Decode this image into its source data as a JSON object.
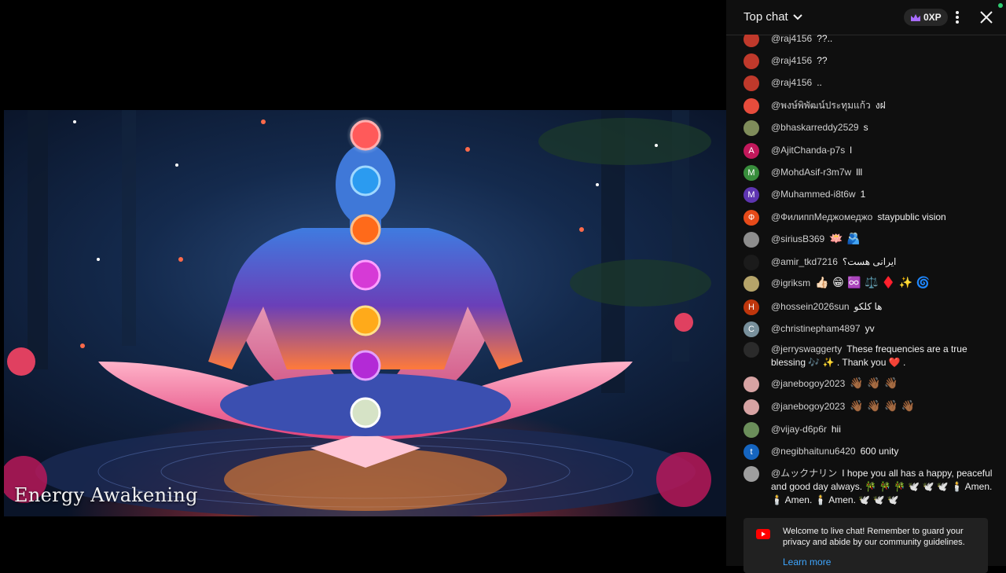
{
  "video": {
    "caption": "Energy Awakening"
  },
  "chat": {
    "title": "Top chat",
    "xp_label": "0XP",
    "welcome_text": "Welcome to live chat! Remember to guard your privacy and abide by our community guidelines.",
    "learn_more": "Learn more",
    "messages": [
      {
        "author": "@raj4156",
        "text": "??..",
        "avatar_letter": "",
        "avatar_color": "#c0392b"
      },
      {
        "author": "@raj4156",
        "text": "??",
        "avatar_letter": "",
        "avatar_color": "#c0392b"
      },
      {
        "author": "@raj4156",
        "text": "..",
        "avatar_letter": "",
        "avatar_color": "#c0392b"
      },
      {
        "author": "@พงษ์พิพัฒน์ประทุมแก้ว",
        "text": "งฝ",
        "avatar_letter": "",
        "avatar_color": "#e74c3c"
      },
      {
        "author": "@bhaskarreddy2529",
        "text": "s",
        "avatar_letter": "",
        "avatar_color": "#7f8c5a"
      },
      {
        "author": "@AjitChanda-p7s",
        "text": "l",
        "avatar_letter": "A",
        "avatar_color": "#c2185b"
      },
      {
        "author": "@MohdAsif-r3m7w",
        "text": "lll",
        "avatar_letter": "M",
        "avatar_color": "#388e3c"
      },
      {
        "author": "@Muhammed-i8t6w",
        "text": "1",
        "avatar_letter": "M",
        "avatar_color": "#5e35b1"
      },
      {
        "author": "@ФилиппМеджомеджо",
        "text": "staypublic vision",
        "avatar_letter": "Ф",
        "avatar_color": "#e64a19"
      },
      {
        "author": "@siriusB369",
        "text": "🪷 🫂",
        "avatar_letter": "",
        "avatar_color": "#8d8d8d"
      },
      {
        "author": "@amir_tkd7216",
        "text": "ایرانی هست؟",
        "avatar_letter": "",
        "avatar_color": "#1b1b1b"
      },
      {
        "author": "@igriksm",
        "text": "👍🏻 😁 ♾️ ⚖️ ♦️ ✨ 🌀",
        "avatar_letter": "",
        "avatar_color": "#b5a46a"
      },
      {
        "author": "@hossein2026sun",
        "text": "ها کلکو",
        "avatar_letter": "H",
        "avatar_color": "#bf360c"
      },
      {
        "author": "@christinepham4897",
        "text": "yv",
        "avatar_letter": "C",
        "avatar_color": "#78909c"
      },
      {
        "author": "@jerryswaggerty",
        "text": "These frequencies are a true blessing 🎶 ✨ . Thank you ❤️ .",
        "avatar_letter": "",
        "avatar_color": "#2b2b2b"
      },
      {
        "author": "@janebogoy2023",
        "text": "👋🏾 👋🏾 👋🏾",
        "avatar_letter": "",
        "avatar_color": "#d7a3a3"
      },
      {
        "author": "@janebogoy2023",
        "text": "👋🏾 👋🏾 👋🏾 👋🏾",
        "avatar_letter": "",
        "avatar_color": "#d7a3a3"
      },
      {
        "author": "@vijay-d6p6r",
        "text": "hii",
        "avatar_letter": "",
        "avatar_color": "#6b8e5a"
      },
      {
        "author": "@negibhaitunu6420",
        "text": "600 unity",
        "avatar_letter": "t",
        "avatar_color": "#1565c0"
      },
      {
        "author": "@ムックナリン",
        "text": "I hope you all has a happy, peaceful and good day always. 🎋 🎋 🎋 🕊️ 🕊️ 🕊️ 🕯️ Amen. 🕯️ Amen. 🕯️ Amen. 🕊️ 🕊️ 🕊️",
        "avatar_letter": "",
        "avatar_color": "#9e9e9e"
      }
    ]
  }
}
